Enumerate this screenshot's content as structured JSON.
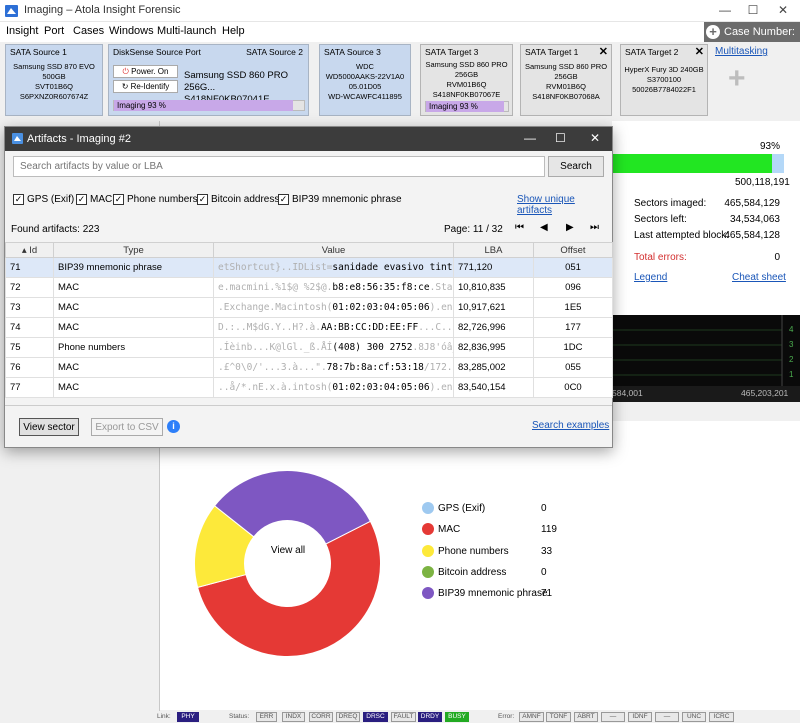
{
  "window": {
    "title": "Imaging – Atola Insight Forensic",
    "minimize": "—",
    "maximize": "☐",
    "close": "✕"
  },
  "menu": [
    "Insight",
    "Port",
    "Cases",
    "Windows",
    "Multi-launch",
    "Help"
  ],
  "case_number": "Case Number: 14",
  "ports": [
    {
      "header": "SATA Source 1",
      "lines": [
        "Samsung SSD 870 EVO",
        "500GB",
        "SVT01B6Q",
        "S6PXNZ0R607674Z"
      ]
    },
    {
      "header_left": "DiskSense Source Port",
      "header_right": "SATA Source 2",
      "power_on": "Power. On",
      "re_identify": "Re-Identify",
      "lines": [
        "Samsung SSD 860 PRO 256G...",
        "S418NF0KB07041E"
      ],
      "progress": "Imaging 93 %",
      "progress_value": 93
    },
    {
      "header": "SATA Source 3",
      "lines": [
        "WDC",
        "WD5000AAKS-22V1A0",
        "05.01D05",
        "WD-WCAWFC411895"
      ]
    },
    {
      "header": "SATA Target 3",
      "lines": [
        "Samsung SSD 860 PRO",
        "256GB",
        "RVM01B6Q",
        "S418NF0KB07067E"
      ],
      "progress": "Imaging 93 %",
      "progress_value": 93
    },
    {
      "header": "SATA Target 1",
      "lines": [
        "Samsung SSD 860 PRO",
        "256GB",
        "RVM01B6Q",
        "S418NF0KB07068A"
      ]
    },
    {
      "header": "SATA Target 2",
      "lines": [
        "HyperX Fury 3D 240GB",
        "S3700100",
        "50026B7784022F1"
      ]
    }
  ],
  "multitasking": "Multitasking",
  "main_progress": {
    "percent_label": "93%",
    "value": 93,
    "total_label": "500,118,191"
  },
  "stats": [
    {
      "label": "Sectors imaged:",
      "value": "465,584,129"
    },
    {
      "label": "Sectors left:",
      "value": "34,534,063"
    },
    {
      "label": "Last attempted block:",
      "value": "465,584,128"
    },
    {
      "label": "Total errors:",
      "value": "0"
    }
  ],
  "legend_link": "Legend",
  "cheat_sheet_link": "Cheat sheet",
  "graph": {
    "ticks": [
      "4",
      "3",
      "2",
      "1"
    ],
    "x_left": "584,001",
    "x_right": "465,203,201"
  },
  "dialog": {
    "title": "Artifacts - Imaging #2",
    "search_placeholder": "Search artifacts by value or LBA",
    "search_button": "Search",
    "filters": [
      "GPS (Exif)",
      "MAC",
      "Phone numbers",
      "Bitcoin address",
      "BIP39 mnemonic phrase"
    ],
    "show_unique": "Show unique artifacts",
    "found": "Found artifacts: 223",
    "page": "Page: 11 / 32",
    "columns": [
      "Id",
      "Type",
      "Value",
      "LBA",
      "Offset"
    ],
    "rows": [
      {
        "id": "71",
        "type": "BIP39 mnemonic phrase",
        "pre": "etShortcut}..IDList=",
        "match": "sanidade evasivo tinteiro mano",
        "post": "",
        "lba": "771,120",
        "offset": "051"
      },
      {
        "id": "72",
        "type": "MAC",
        "pre": "e.macmini.%1$@ %2$@.",
        "match": "b8:e8:56:35:f8:ce",
        "post": ".State:/Netwo",
        "lba": "10,810,835",
        "offset": "096"
      },
      {
        "id": "73",
        "type": "MAC",
        "pre": ".Exchange.Macintosh(",
        "match": "01:02:03:04:05:06",
        "post": ").en0.Macinto",
        "lba": "10,917,621",
        "offset": "1E5"
      },
      {
        "id": "74",
        "type": "MAC",
        "pre": "D.:..M$dG.Y..H?.à.",
        "match": "AA:BB:CC:DD:EE:FF",
        "post": "...C...m.V..Ü",
        "lba": "82,726,996",
        "offset": "177"
      },
      {
        "id": "75",
        "type": "Phone numbers",
        "pre": ".Íèinb...K@lGl._ß.ÅÍ",
        "match": "(408) 300 2752",
        "post": ".8J8'óâ_no_n..",
        "lba": "82,836,995",
        "offset": "1DC"
      },
      {
        "id": "76",
        "type": "MAC",
        "pre": ".£^0\\0/'...3.à...\".",
        "match": "78:7b:8a:cf:53:18",
        "post": "/172.20.128.1",
        "lba": "83,285,002",
        "offset": "055"
      },
      {
        "id": "77",
        "type": "MAC",
        "pre": "..å/*.nE.x.à.intosh(",
        "match": "01:02:03:04:05:06",
        "post": ").en0ßîñ.j.h.",
        "lba": "83,540,154",
        "offset": "0C0"
      }
    ],
    "view_sector": "View sector",
    "export_csv": "Export to CSV",
    "search_examples": "Search examples"
  },
  "donut": {
    "center_label": "View all",
    "colors": [
      "#9ec9f0",
      "#e53935",
      "#fde93a",
      "#7cb342",
      "#7e57c2"
    ],
    "items": [
      {
        "label": "GPS (Exif)",
        "count": 0
      },
      {
        "label": "MAC",
        "count": 119
      },
      {
        "label": "Phone numbers",
        "count": 33
      },
      {
        "label": "Bitcoin address",
        "count": 0
      },
      {
        "label": "BIP39 mnemonic phrase",
        "count": 71
      }
    ]
  },
  "statusbar": {
    "link_label": "Link:",
    "link_phy": "PHY",
    "status_label": "Status:",
    "status": [
      "ERR",
      "INDX",
      "CORR",
      "DREQ",
      "DRSC",
      "FAULT",
      "DRDY",
      "BUSY"
    ],
    "error_label": "Error:",
    "errors": [
      "AMNF",
      "TONF",
      "ABRT",
      "—",
      "IDNF",
      "—",
      "UNC",
      "ICRC"
    ]
  }
}
